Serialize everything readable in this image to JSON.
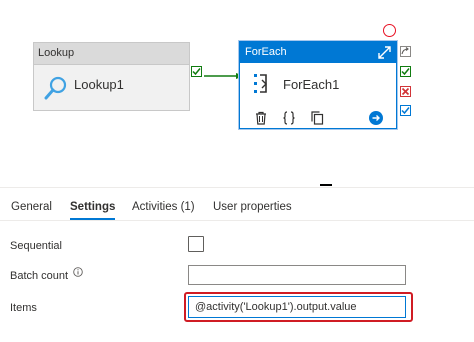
{
  "canvas": {
    "lookup_activity": {
      "type_label": "Lookup",
      "name": "Lookup1",
      "icon": "magnifier-icon"
    },
    "foreach_activity": {
      "type_label": "ForEach",
      "name": "ForEach1",
      "icon": "foreach-icon"
    }
  },
  "tabs": [
    {
      "label": "General",
      "active": false
    },
    {
      "label": "Settings",
      "active": true
    },
    {
      "label": "Activities (1)",
      "active": false
    },
    {
      "label": "User properties",
      "active": false
    }
  ],
  "settings": {
    "sequential_label": "Sequential",
    "sequential_checked": false,
    "batch_count_label": "Batch count",
    "batch_count_value": "",
    "items_label": "Items",
    "items_value": "@activity('Lookup1').output.value"
  },
  "colors": {
    "accent": "#0078d4",
    "success": "#107c10",
    "error": "#d13438",
    "highlight": "#d01c24"
  }
}
